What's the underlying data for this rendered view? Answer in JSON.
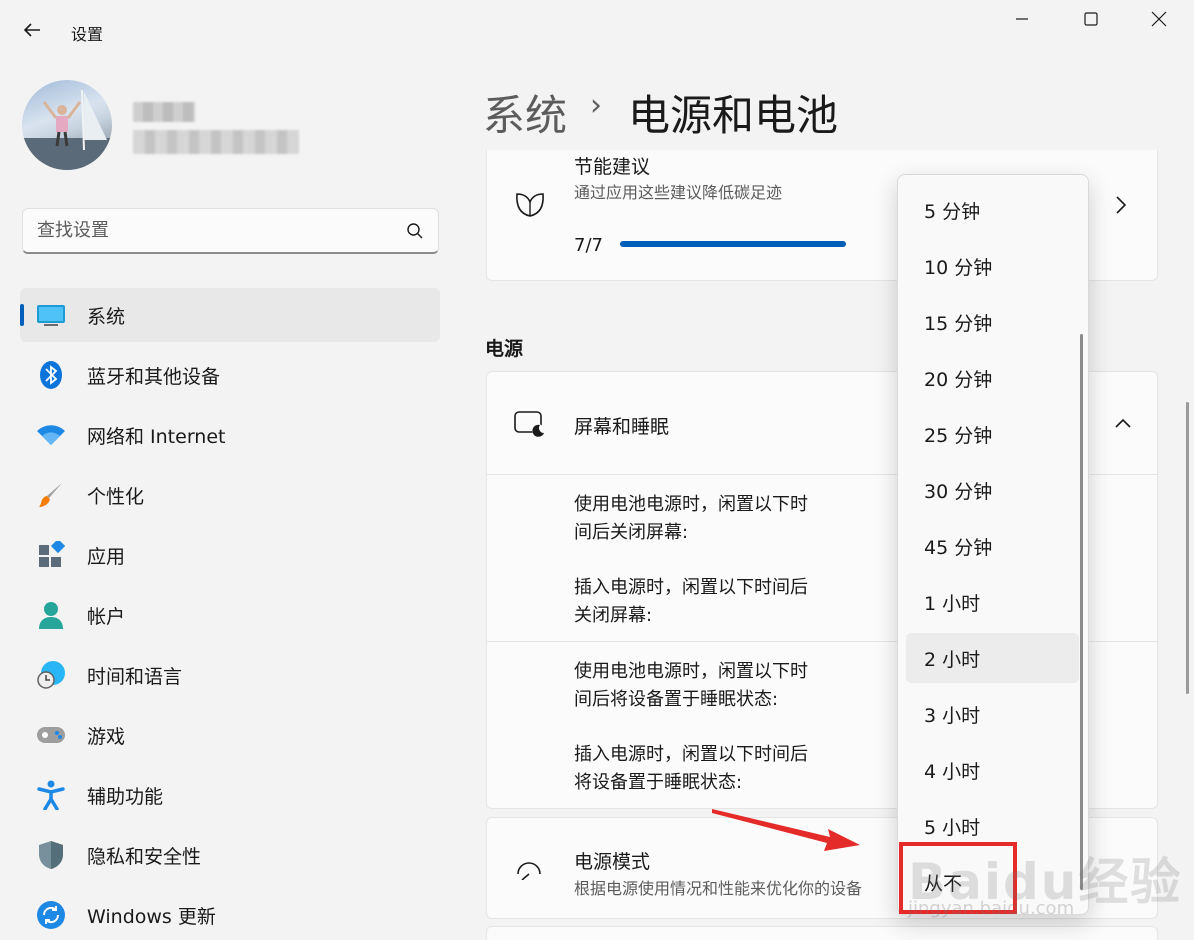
{
  "window": {
    "title": "设置"
  },
  "search": {
    "placeholder": "查找设置"
  },
  "nav": [
    {
      "label": "系统",
      "icon": "monitor-icon",
      "active": true
    },
    {
      "label": "蓝牙和其他设备",
      "icon": "bluetooth-icon"
    },
    {
      "label": "网络和 Internet",
      "icon": "wifi-icon"
    },
    {
      "label": "个性化",
      "icon": "brush-icon"
    },
    {
      "label": "应用",
      "icon": "apps-icon"
    },
    {
      "label": "帐户",
      "icon": "person-icon"
    },
    {
      "label": "时间和语言",
      "icon": "globe-clock-icon"
    },
    {
      "label": "游戏",
      "icon": "gamepad-icon"
    },
    {
      "label": "辅助功能",
      "icon": "accessibility-icon"
    },
    {
      "label": "隐私和安全性",
      "icon": "shield-icon"
    },
    {
      "label": "Windows 更新",
      "icon": "update-icon"
    }
  ],
  "breadcrumb": {
    "parent": "系统",
    "separator": "›",
    "current": "电源和电池"
  },
  "eco": {
    "title": "节能建议",
    "desc": "通过应用这些建议降低碳足迹",
    "count": "7/7",
    "progress": 1.0
  },
  "power": {
    "section": "电源",
    "screen_sleep": {
      "title": "屏幕和睡眠",
      "rows": [
        {
          "line1": "使用电池电源时，闲置以下时",
          "line2": "间后关闭屏幕:"
        },
        {
          "line1": "插入电源时，闲置以下时间后",
          "line2": "关闭屏幕:"
        },
        {
          "line1": "使用电池电源时，闲置以下时",
          "line2": "间后将设备置于睡眠状态:"
        },
        {
          "line1": "插入电源时，闲置以下时间后",
          "line2": "将设备置于睡眠状态:"
        }
      ]
    },
    "mode": {
      "title": "电源模式",
      "desc": "根据电源使用情况和性能来优化你的设备"
    }
  },
  "dropdown": {
    "options": [
      "5 分钟",
      "10 分钟",
      "15 分钟",
      "20 分钟",
      "25 分钟",
      "30 分钟",
      "45 分钟",
      "1 小时",
      "2 小时",
      "3 小时",
      "4 小时",
      "5 小时",
      "从不"
    ],
    "selected_index": 8
  },
  "watermark": {
    "brand": "Baidu经验",
    "site": "jingyan.baidu.com"
  },
  "colors": {
    "accent": "#005fb8",
    "annotation": "#e52a2a"
  }
}
